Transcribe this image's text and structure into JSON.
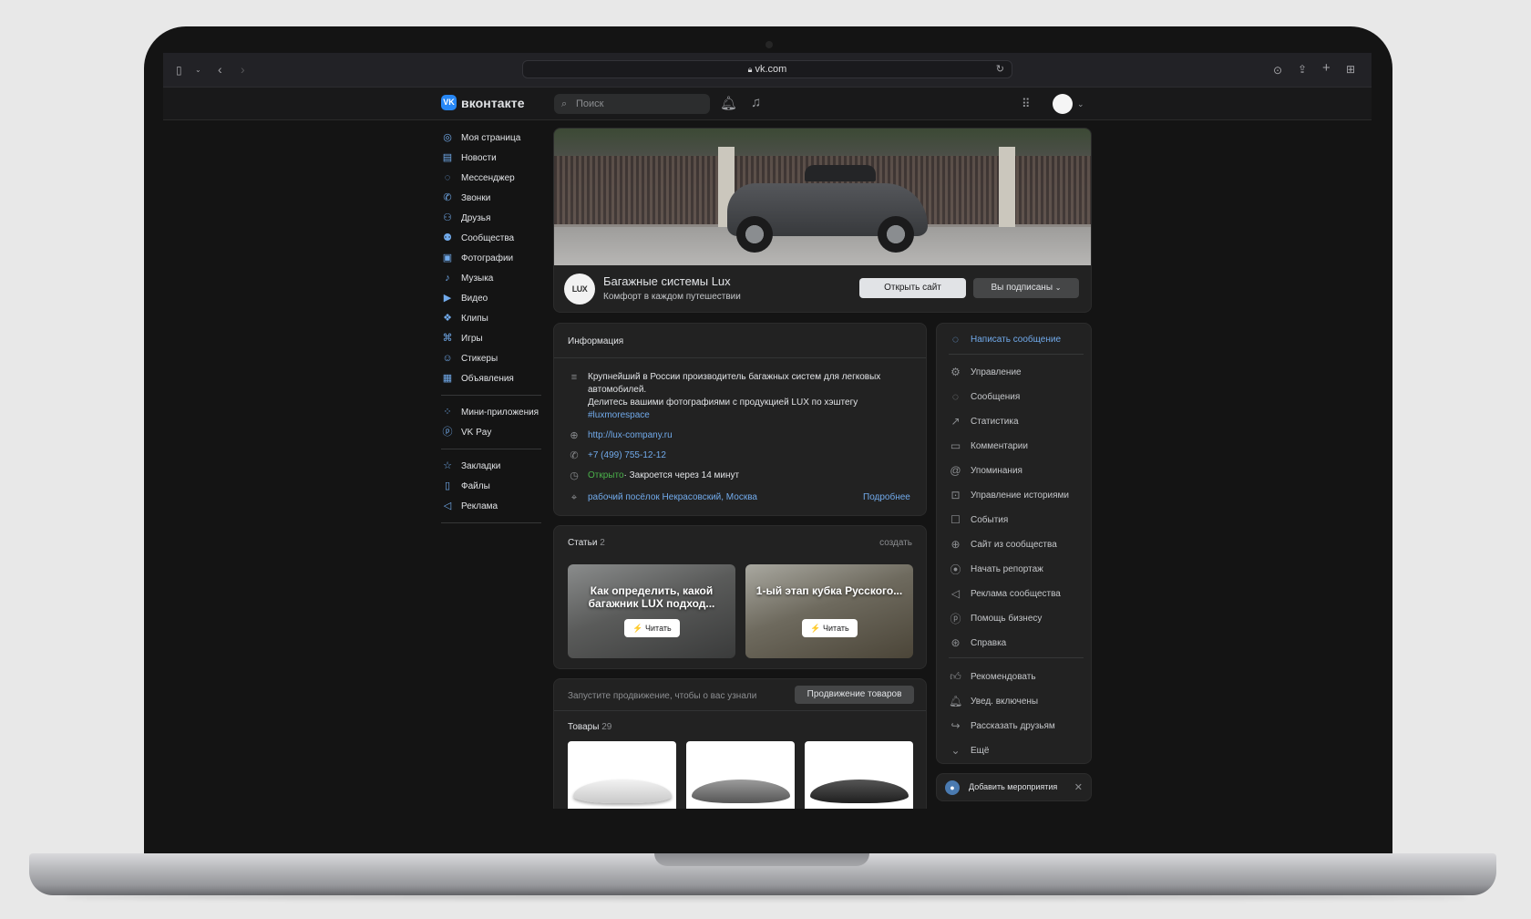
{
  "browser": {
    "url": "vk.com"
  },
  "vk": {
    "logo_text": "вконтакте",
    "search_placeholder": "Поиск"
  },
  "nav": {
    "items": [
      {
        "label": "Моя страница",
        "icon": "profile-icon"
      },
      {
        "label": "Новости",
        "icon": "news-icon"
      },
      {
        "label": "Мессенджер",
        "icon": "messenger-icon"
      },
      {
        "label": "Звонки",
        "icon": "phone-icon"
      },
      {
        "label": "Друзья",
        "icon": "friends-icon"
      },
      {
        "label": "Сообщества",
        "icon": "communities-icon"
      },
      {
        "label": "Фотографии",
        "icon": "photo-icon"
      },
      {
        "label": "Музыка",
        "icon": "music-icon"
      },
      {
        "label": "Видео",
        "icon": "video-icon"
      },
      {
        "label": "Клипы",
        "icon": "clips-icon"
      },
      {
        "label": "Игры",
        "icon": "games-icon"
      },
      {
        "label": "Стикеры",
        "icon": "stickers-icon"
      },
      {
        "label": "Объявления",
        "icon": "ads-icon"
      }
    ],
    "apps": [
      {
        "label": "Мини-приложения",
        "icon": "apps-icon"
      },
      {
        "label": "VK Pay",
        "icon": "vkpay-icon"
      }
    ],
    "extra": [
      {
        "label": "Закладки",
        "icon": "bookmark-icon"
      },
      {
        "label": "Файлы",
        "icon": "file-icon"
      },
      {
        "label": "Реклама",
        "icon": "megaphone-icon"
      }
    ]
  },
  "group": {
    "name": "Багажные системы Lux",
    "status": "Комфорт в каждом путешествии",
    "avatar_text": "LUX",
    "open_site_button": "Открыть сайт",
    "subscribed_button": "Вы подписаны"
  },
  "info": {
    "title": "Информация",
    "description_1": "Крупнейший в России производитель багажных систем для легковых",
    "description_2": "автомобилей.",
    "description_3": "Делитесь вашими фотографиями с продукцией LUX по хэштегу",
    "hashtag": "#luxmorespace",
    "website": "http://lux-company.ru",
    "phone": "+7 (499) 755-12-12",
    "open_status": "Открыто",
    "closes_text": " · Закроется через 14 минут",
    "address": "рабочий посёлок Некрасовский, Москва",
    "more_link": "Подробнее"
  },
  "articles": {
    "title": "Статьи",
    "count": "2",
    "create_link": "создать",
    "items": [
      {
        "title": "Как определить, какой багажник LUX подход...",
        "read_label": "⚡ Читать"
      },
      {
        "title": "1-ый этап кубка Русского...",
        "read_label": "⚡ Читать"
      }
    ]
  },
  "promo": {
    "text": "Запустите продвижение, чтобы о вас узнали",
    "button": "Продвижение товаров"
  },
  "products": {
    "title": "Товары",
    "count": "29"
  },
  "actions": {
    "write_message": "Написать сообщение",
    "manage_items": [
      {
        "label": "Управление",
        "icon": "gear-icon"
      },
      {
        "label": "Сообщения",
        "icon": "chat-icon"
      },
      {
        "label": "Статистика",
        "icon": "chart-icon"
      },
      {
        "label": "Комментарии",
        "icon": "comment-icon"
      },
      {
        "label": "Упоминания",
        "icon": "at-icon"
      },
      {
        "label": "Управление историями",
        "icon": "stories-icon"
      },
      {
        "label": "События",
        "icon": "event-icon"
      },
      {
        "label": "Сайт из сообщества",
        "icon": "globe-icon"
      },
      {
        "label": "Начать репортаж",
        "icon": "broadcast-icon"
      },
      {
        "label": "Реклама сообщества",
        "icon": "megaphone-icon"
      },
      {
        "label": "Помощь бизнесу",
        "icon": "business-icon"
      },
      {
        "label": "Справка",
        "icon": "help-icon"
      }
    ],
    "social_items": [
      {
        "label": "Рекомендовать",
        "icon": "like-icon"
      },
      {
        "label": "Увед. включены",
        "icon": "bell-icon"
      },
      {
        "label": "Рассказать друзьям",
        "icon": "share-icon"
      },
      {
        "label": "Ещё",
        "icon": "chevron-down-icon"
      }
    ],
    "add_event": "Добавить мероприятия"
  }
}
